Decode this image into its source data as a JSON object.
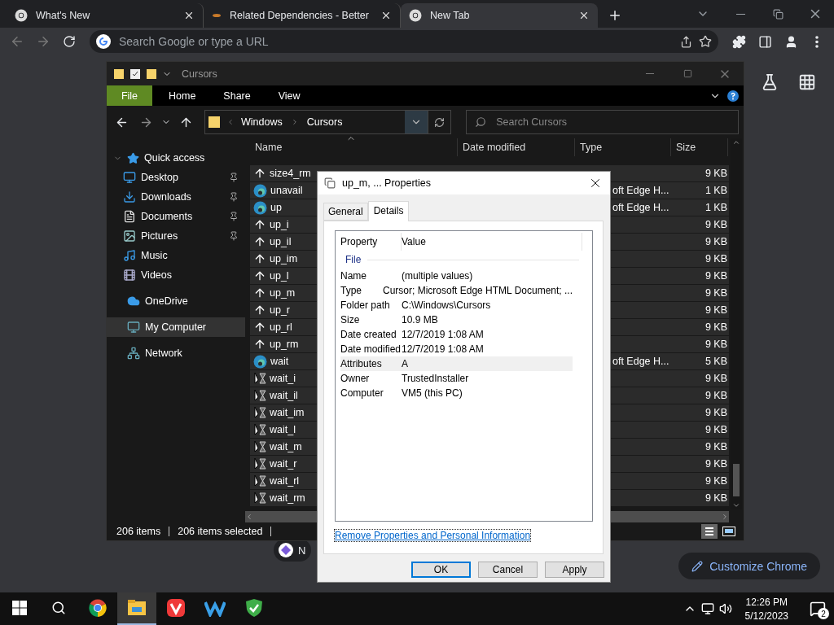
{
  "browser": {
    "tabs": [
      {
        "title": "What's New",
        "kind": "chrome",
        "selected": false
      },
      {
        "title": "Related Dependencies - Better",
        "kind": "site",
        "selected": false
      },
      {
        "title": "New Tab",
        "kind": "chrome",
        "selected": true
      }
    ],
    "omnibox": {
      "placeholder": "Search Google or type a URL"
    }
  },
  "new_tab": {
    "shortcut": {
      "label": "N"
    },
    "customize_button": "Customize Chrome"
  },
  "explorer": {
    "title": "Cursors",
    "ribbon_tabs": [
      {
        "label": "File",
        "highlighted": true
      },
      {
        "label": "Home",
        "highlighted": false
      },
      {
        "label": "Share",
        "highlighted": false
      },
      {
        "label": "View",
        "highlighted": false
      }
    ],
    "breadcrumb": [
      "Windows",
      "Cursors"
    ],
    "search": {
      "placeholder": "Search Cursors"
    },
    "sidebar": [
      {
        "label": "Quick access",
        "expanded": true,
        "selected": false,
        "children": [
          {
            "label": "Desktop",
            "pinned": true,
            "selected": false
          },
          {
            "label": "Downloads",
            "pinned": true,
            "selected": false
          },
          {
            "label": "Documents",
            "pinned": true,
            "selected": false
          },
          {
            "label": "Pictures",
            "pinned": true,
            "selected": false
          },
          {
            "label": "Music",
            "pinned": false,
            "selected": false
          },
          {
            "label": "Videos",
            "pinned": false,
            "selected": false
          }
        ]
      },
      {
        "label": "OneDrive",
        "selected": false
      },
      {
        "label": "My Computer",
        "selected": true
      },
      {
        "label": "Network",
        "selected": false
      }
    ],
    "columns": [
      "Name",
      "Date modified",
      "Type",
      "Size"
    ],
    "rows": [
      {
        "name": "size4_rm",
        "kind": "cursor",
        "size": "9 KB",
        "selected": true
      },
      {
        "name": "unavail",
        "kind": "html",
        "type": "oft Edge H...",
        "size": "1 KB",
        "selected": true
      },
      {
        "name": "up",
        "kind": "html",
        "type": "oft Edge H...",
        "size": "1 KB",
        "selected": true
      },
      {
        "name": "up_i",
        "kind": "cursor",
        "size": "9 KB",
        "selected": true
      },
      {
        "name": "up_il",
        "kind": "cursor",
        "size": "9 KB",
        "selected": true
      },
      {
        "name": "up_im",
        "kind": "cursor",
        "size": "9 KB",
        "selected": true
      },
      {
        "name": "up_l",
        "kind": "cursor",
        "size": "9 KB",
        "selected": true
      },
      {
        "name": "up_m",
        "kind": "cursor",
        "size": "9 KB",
        "selected": true
      },
      {
        "name": "up_r",
        "kind": "cursor",
        "size": "9 KB",
        "selected": true
      },
      {
        "name": "up_rl",
        "kind": "cursor",
        "size": "9 KB",
        "selected": true
      },
      {
        "name": "up_rm",
        "kind": "cursor",
        "size": "9 KB",
        "selected": true
      },
      {
        "name": "wait",
        "kind": "html",
        "type": "oft Edge H...",
        "size": "5 KB",
        "selected": true
      },
      {
        "name": "wait_i",
        "kind": "animated",
        "size": "9 KB",
        "selected": true
      },
      {
        "name": "wait_il",
        "kind": "animated",
        "size": "9 KB",
        "selected": true
      },
      {
        "name": "wait_im",
        "kind": "animated",
        "size": "9 KB",
        "selected": true
      },
      {
        "name": "wait_l",
        "kind": "animated",
        "size": "9 KB",
        "selected": true
      },
      {
        "name": "wait_m",
        "kind": "animated",
        "size": "9 KB",
        "selected": true
      },
      {
        "name": "wait_r",
        "kind": "animated",
        "size": "9 KB",
        "selected": true
      },
      {
        "name": "wait_rl",
        "kind": "animated",
        "size": "9 KB",
        "selected": true
      },
      {
        "name": "wait_rm",
        "kind": "animated",
        "size": "9 KB",
        "selected": true
      }
    ],
    "status": [
      "206 items",
      "206 items selected"
    ]
  },
  "dialog": {
    "title": "up_m, ... Properties",
    "tabs": [
      {
        "label": "General",
        "selected": false
      },
      {
        "label": "Details",
        "selected": true
      }
    ],
    "headers": [
      "Property",
      "Value"
    ],
    "group": "File",
    "properties": [
      {
        "property": "Name",
        "value": "(multiple values)",
        "highlighted": false
      },
      {
        "property": "Type",
        "value": "Cursor; Microsoft Edge HTML Document; ...",
        "highlighted": false
      },
      {
        "property": "Folder path",
        "value": "C:\\Windows\\Cursors",
        "highlighted": false
      },
      {
        "property": "Size",
        "value": "10.9 MB",
        "highlighted": false
      },
      {
        "property": "Date created",
        "value": "12/7/2019 1:08 AM",
        "highlighted": false
      },
      {
        "property": "Date modified",
        "value": "12/7/2019 1:08 AM",
        "highlighted": false
      },
      {
        "property": "Attributes",
        "value": "A",
        "highlighted": true
      },
      {
        "property": "Owner",
        "value": "TrustedInstaller",
        "highlighted": false
      },
      {
        "property": "Computer",
        "value": "VM5 (this PC)",
        "highlighted": false
      }
    ],
    "link": "Remove Properties and Personal Information",
    "buttons": [
      {
        "label": "OK",
        "default": true
      },
      {
        "label": "Cancel",
        "default": false
      },
      {
        "label": "Apply",
        "default": false
      }
    ]
  },
  "taskbar": {
    "apps": [
      {
        "kind": "chrome",
        "active": false
      },
      {
        "kind": "explorer",
        "active": true
      },
      {
        "kind": "vivaldi",
        "active": false
      },
      {
        "kind": "wave",
        "active": false
      },
      {
        "kind": "shield",
        "active": false
      }
    ],
    "time": "12:26 PM",
    "date": "5/12/2023",
    "notifications": "2"
  }
}
